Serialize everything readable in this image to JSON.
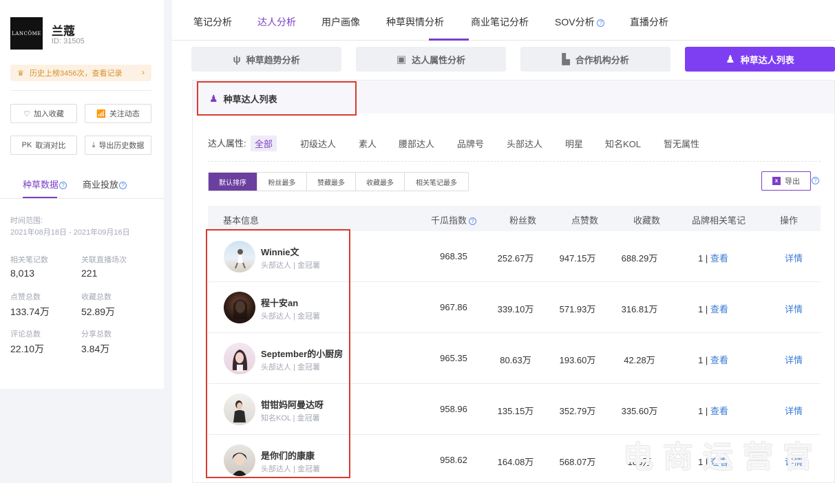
{
  "brand": {
    "logo_text": "LANCÔME",
    "name": "兰蔻",
    "id_label": "ID: 31505",
    "history_text": "历史上榜3456次，查看记录"
  },
  "left_buttons": {
    "favorite": "加入收藏",
    "follow": "关注动态",
    "pk_prefix": "PK",
    "compare": "取消对比",
    "export_history": "导出历史数据"
  },
  "left_tabs": [
    "种草数据",
    "商业投放"
  ],
  "time_range": {
    "label": "时间范围:",
    "value": "2021年08月18日 - 2021年09月16日"
  },
  "stats": [
    {
      "label": "相关笔记数",
      "value": "8,013"
    },
    {
      "label": "关联直播场次",
      "value": "221"
    },
    {
      "label": "点赞总数",
      "value": "133.74万"
    },
    {
      "label": "收藏总数",
      "value": "52.89万"
    },
    {
      "label": "评论总数",
      "value": "22.10万"
    },
    {
      "label": "分享总数",
      "value": "3.84万"
    }
  ],
  "top_nav": [
    "笔记分析",
    "达人分析",
    "用户画像",
    "种草舆情分析",
    "商业笔记分析",
    "SOV分析",
    "直播分析"
  ],
  "sub_tabs": [
    {
      "label": "种草趋势分析",
      "icon": "sprout-icon"
    },
    {
      "label": "达人属性分析",
      "icon": "profile-card-icon"
    },
    {
      "label": "合作机构分析",
      "icon": "building-icon"
    },
    {
      "label": "种草达人列表",
      "icon": "person-icon"
    }
  ],
  "card_title": "种草达人列表",
  "filter_label": "达人属性:",
  "filters": [
    "全部",
    "初级达人",
    "素人",
    "腰部达人",
    "品牌号",
    "头部达人",
    "明星",
    "知名KOL",
    "暂无属性"
  ],
  "sort_buttons": [
    "默认排序",
    "粉丝最多",
    "赞藏最多",
    "收藏最多",
    "相关笔记最多"
  ],
  "export_label": "导出",
  "export_icon_text": "x",
  "table_headers": {
    "basic": "基本信息",
    "index": "千瓜指数",
    "fans": "粉丝数",
    "likes": "点赞数",
    "collects": "收藏数",
    "brand_notes": "品牌相关笔记",
    "action": "操作"
  },
  "view_label": "查看",
  "detail_label": "详情",
  "rows": [
    {
      "name": "Winnie文",
      "tag": "头部达人 | 金冠薯",
      "index": "968.35",
      "fans": "252.67万",
      "likes": "947.15万",
      "collects": "688.29万",
      "notes": "1 |"
    },
    {
      "name": "程十安an",
      "tag": "头部达人 | 金冠薯",
      "index": "967.86",
      "fans": "339.10万",
      "likes": "571.93万",
      "collects": "316.81万",
      "notes": "1 |"
    },
    {
      "name": "September的小厨房",
      "tag": "头部达人 | 金冠薯",
      "index": "965.35",
      "fans": "80.63万",
      "likes": "193.60万",
      "collects": "42.28万",
      "notes": "1 |"
    },
    {
      "name": "钳钳妈阿曼达呀",
      "tag": "知名KOL | 金冠薯",
      "index": "958.96",
      "fans": "135.15万",
      "likes": "352.79万",
      "collects": "335.60万",
      "notes": "1 |"
    },
    {
      "name": "是你们的康康",
      "tag": "头部达人 | 金冠薯",
      "index": "958.62",
      "fans": "164.08万",
      "likes": "568.07万",
      "collects": "186万",
      "notes": "1 |"
    }
  ],
  "help_mark": "?",
  "watermark": "电商运营官"
}
